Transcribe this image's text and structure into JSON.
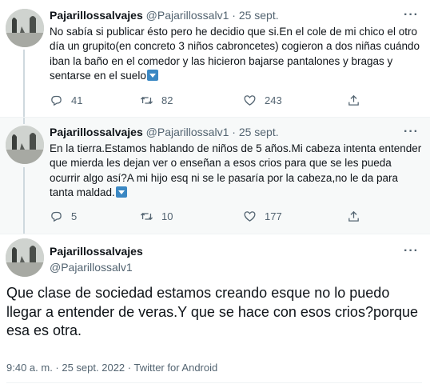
{
  "colors": {
    "text": "#0f1419",
    "secondary": "#536471",
    "thread_line": "#cfd9de",
    "highlight_bg": "#f7f9f9",
    "emoji_blue": "#3b88c3"
  },
  "tweets": [
    {
      "name": "Pajarillossalvajes",
      "handle": "@Pajarillossalv1",
      "sep": "·",
      "date": "25 sept.",
      "more": "···",
      "text": "No sabía si publicar ésto pero he decidio que si.En el cole de mi chico el otro día un grupito(en concreto 3 niños cabroncetes) cogieron a dos niñas cuándo iban la baño en el comedor y las hicieron bajarse pantalones y bragas y sentarse en el suelo",
      "emoji": "down-arrow-button-emoji",
      "replies": "41",
      "retweets": "82",
      "likes": "243"
    },
    {
      "name": "Pajarillossalvajes",
      "handle": "@Pajarillossalv1",
      "sep": "·",
      "date": "25 sept.",
      "more": "···",
      "text": "En la tierra.Estamos hablando de niños de 5 años.Mi cabeza intenta entender que mierda les dejan ver o enseñan a esos crios para que se les pueda ocurrir algo así?A mi hijo esq ni se le pasaría por la cabeza,no le da para tanta maldad.",
      "emoji": "down-arrow-button-emoji",
      "replies": "5",
      "retweets": "10",
      "likes": "177"
    }
  ],
  "main_tweet": {
    "name": "Pajarillossalvajes",
    "handle": "@Pajarillossalv1",
    "more": "···",
    "text": "Que clase de sociedad estamos creando esque no lo puedo llegar a entender de veras.Y que se hace con esos crios?porque esa es otra.",
    "meta": "9:40 a. m. · 25 sept. 2022 · Twitter for Android"
  },
  "icons": {
    "reply": "reply-icon",
    "retweet": "retweet-icon",
    "like": "like-icon",
    "share": "share-icon",
    "more": "more-options-icon"
  }
}
